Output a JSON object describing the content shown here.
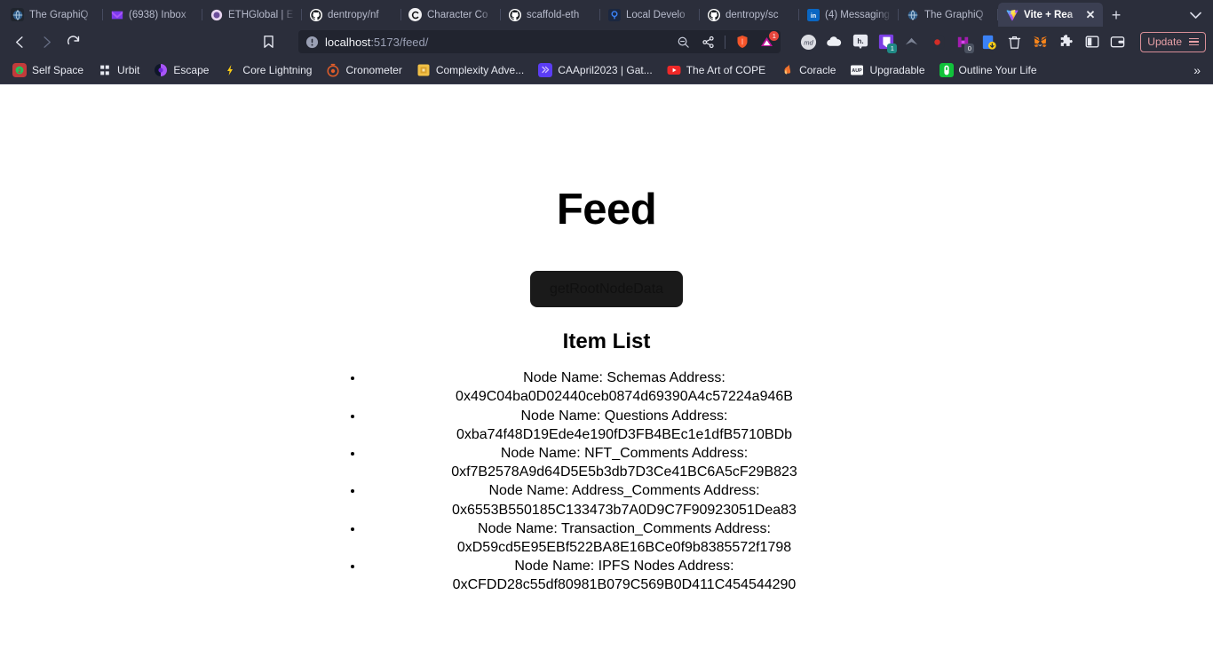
{
  "browser": {
    "tabs": [
      {
        "title": "The GraphiQ",
        "favicon": "globe-icon",
        "active": false
      },
      {
        "title": "(6938) Inbox",
        "favicon": "mail-icon",
        "active": false
      },
      {
        "title": "ETHGlobal | E",
        "favicon": "ethglobal-icon",
        "active": false
      },
      {
        "title": "dentropy/nf",
        "favicon": "github-icon",
        "active": false
      },
      {
        "title": "Character Co",
        "favicon": "character-icon",
        "active": false
      },
      {
        "title": "scaffold-eth",
        "favicon": "github-icon",
        "active": false
      },
      {
        "title": "Local Develo",
        "favicon": "local-dev-icon",
        "active": false
      },
      {
        "title": "dentropy/sc",
        "favicon": "github-icon",
        "active": false
      },
      {
        "title": "(4) Messaging",
        "favicon": "linkedin-icon",
        "active": false
      },
      {
        "title": "The GraphiQ",
        "favicon": "globe-icon",
        "active": false
      },
      {
        "title": "Vite + Rea",
        "favicon": "vite-icon",
        "active": true
      }
    ],
    "new_tab_label": "+",
    "tab_list_label": "⌄",
    "close_tab_label": "✕",
    "nav": {
      "back_icon": "back-arrow-icon",
      "forward_icon": "forward-arrow-icon",
      "reload_icon": "reload-icon",
      "bookmark_icon": "bookmark-icon"
    },
    "url": {
      "host": "localhost",
      "path": ":5173/feed/",
      "full": "localhost:5173/feed/",
      "security_icon": "not-secure-icon",
      "zoom_out_icon": "zoom-out-icon",
      "share_icon": "share-icon",
      "shield_icon": "brave-shield-icon",
      "shield_badge": "1"
    },
    "extensions": [
      {
        "name": "markdownload-icon",
        "label": "md",
        "badge": ""
      },
      {
        "name": "cloud-icon",
        "label": "",
        "badge": ""
      },
      {
        "name": "hypothesis-icon",
        "label": "h.",
        "badge": ""
      },
      {
        "name": "pocket-icon",
        "label": "",
        "badge": "1"
      },
      {
        "name": "arrow-extension-icon",
        "label": "",
        "badge": ""
      },
      {
        "name": "lastpass-icon",
        "label": "",
        "badge": ""
      },
      {
        "name": "purple-extension-icon",
        "label": "",
        "badge": "0"
      },
      {
        "name": "download-extension-icon",
        "label": "",
        "badge": ""
      },
      {
        "name": "trash-icon",
        "label": "",
        "badge": ""
      },
      {
        "name": "metamask-icon",
        "label": "",
        "badge": ""
      },
      {
        "name": "puzzle-extensions-icon",
        "label": "",
        "badge": ""
      },
      {
        "name": "sidebar-toggle-icon",
        "label": "",
        "badge": ""
      },
      {
        "name": "wallet-icon",
        "label": "",
        "badge": ""
      }
    ],
    "update_button": {
      "label": "Update",
      "menu_icon": "hamburger-menu-icon"
    },
    "bookmarks": [
      {
        "label": "Self Space",
        "favicon": "self-space-icon"
      },
      {
        "label": "Urbit",
        "favicon": "urbit-icon"
      },
      {
        "label": "Escape",
        "favicon": "escape-icon"
      },
      {
        "label": "Core Lightning",
        "favicon": "core-lightning-icon"
      },
      {
        "label": "Cronometer",
        "favicon": "cronometer-icon"
      },
      {
        "label": "Complexity Adve...",
        "favicon": "complexity-icon"
      },
      {
        "label": "CAApril2023 | Gat...",
        "favicon": "gather-icon"
      },
      {
        "label": "The Art of COPE",
        "favicon": "youtube-icon"
      },
      {
        "label": "Coracle",
        "favicon": "coracle-icon"
      },
      {
        "label": "Upgradable",
        "favicon": "upgradable-icon"
      },
      {
        "label": "Outline Your Life",
        "favicon": "outline-icon"
      }
    ],
    "bookmarks_overflow_label": "»"
  },
  "page": {
    "title": "Feed",
    "get_root_node_data_button": "getRootNodeData",
    "item_list_heading": "Item List",
    "items": [
      "Node Name: Schemas Address: 0x49C04ba0D02440ceb0874d69390A4c57224a946B",
      "Node Name: Questions Address: 0xba74f48D19Ede4e190fD3FB4BEc1e1dfB5710BDb",
      "Node Name: NFT_Comments Address: 0xf7B2578A9d64D5E5b3db7D3Ce41BC6A5cF29B823",
      "Node Name: Address_Comments Address: 0x6553B550185C133473b7A0D9C7F90923051Dea83",
      "Node Name: Transaction_Comments Address: 0xD59cd5E95EBf522BA8E16BCe0f9b8385572f1798",
      "Node Name: IPFS Nodes Address: 0xCFDD28c55df80981B079C569B0D411C454544290"
    ]
  },
  "colors": {
    "chrome_bg": "#2b2e3b",
    "urlbar_bg": "#21242f",
    "active_tab_bg": "#3b3f52",
    "page_bg": "#ffffff",
    "button_bg": "#1a1a1a",
    "update_accent": "#e7a0a6"
  }
}
